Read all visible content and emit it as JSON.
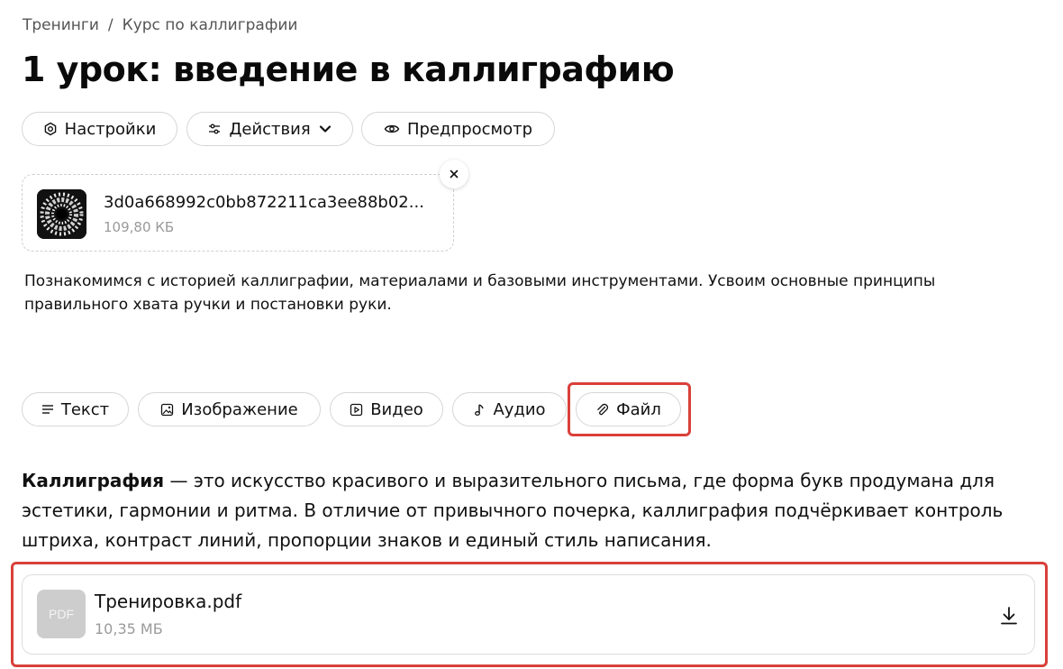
{
  "breadcrumb": {
    "items": [
      "Тренинги",
      "Курс по каллиграфии"
    ],
    "separator": "/"
  },
  "page": {
    "title": "1 урок: введение в каллиграфию"
  },
  "toolbar": {
    "settings_label": "Настройки",
    "actions_label": "Действия",
    "preview_label": "Предпросмотр"
  },
  "attachment": {
    "file_name": "3d0a668992c0bb872211ca3ee88b02...",
    "file_size": "109,80 КБ"
  },
  "lesson": {
    "description": "Познакомимся с историей каллиграфии, материалами и базовыми инструментами. Усвоим основные принципы правильного хвата ручки и постановки руки."
  },
  "blocks": {
    "text_label": "Текст",
    "image_label": "Изображение",
    "video_label": "Видео",
    "audio_label": "Аудио",
    "file_label": "Файл"
  },
  "content": {
    "term": "Каллиграфия",
    "paragraph": " — это искусство красивого и выразительного письма, где форма букв продумана для эстетики, гармонии и ритма. В отличие от привычного почерка, каллиграфия подчёркивает контроль штриха, контраст линий, пропорции знаков и единый стиль написания."
  },
  "file_block": {
    "type_label": "PDF",
    "name": "Тренировка.pdf",
    "size": "10,35 МБ"
  },
  "colors": {
    "highlight": "#d9403a",
    "pdf_thumb": "#cdcdcd",
    "muted_text": "#9a9a9a"
  },
  "icons": [
    "gear-icon",
    "sliders-icon",
    "chevron-down-icon",
    "eye-icon",
    "close-icon",
    "text-lines-icon",
    "image-icon",
    "video-icon",
    "music-note-icon",
    "paperclip-icon",
    "download-icon"
  ]
}
